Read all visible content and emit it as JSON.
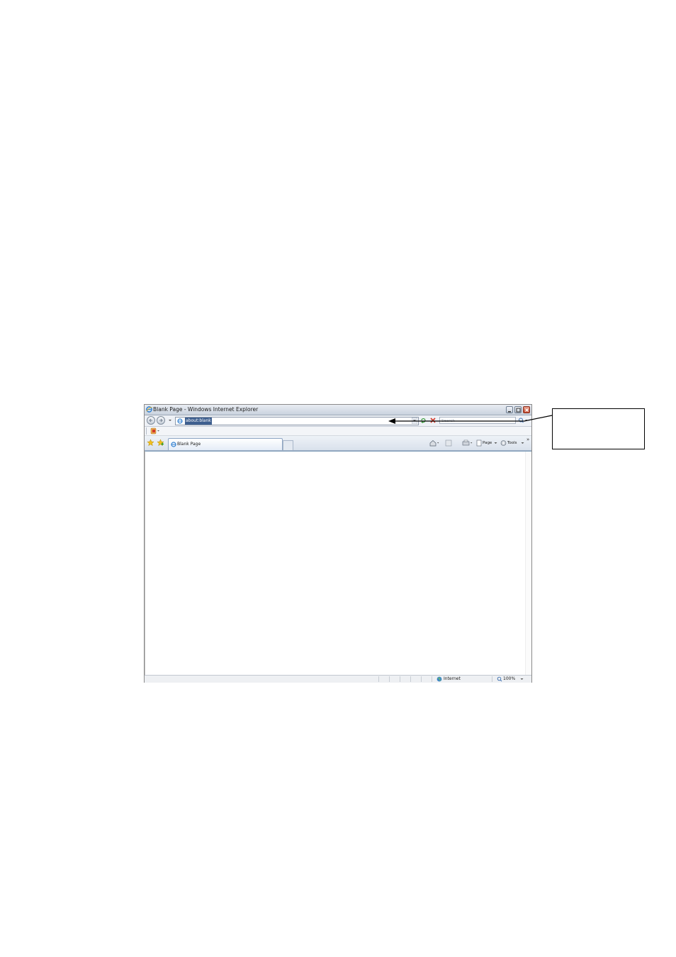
{
  "window": {
    "title": "Blank Page - Windows Internet Explorer"
  },
  "navigation": {
    "address_value": "about:blank",
    "search_placeholder": "Search"
  },
  "tabs": [
    {
      "label": "Blank Page",
      "active": true
    }
  ],
  "command_bar": {
    "page_label": "Page",
    "tools_label": "Tools",
    "overflow_label": "»"
  },
  "status_bar": {
    "zone": "Internet",
    "zoom": "100%"
  },
  "icons": [
    "ie-logo-icon",
    "minimize-icon",
    "maximize-icon",
    "close-icon",
    "back-arrow-icon",
    "forward-arrow-icon",
    "chevron-down-icon",
    "page-icon",
    "refresh-icon",
    "stop-icon",
    "search-icon",
    "feed-icon",
    "favorites-star-icon",
    "add-favorites-icon",
    "home-icon",
    "rss-icon",
    "print-icon",
    "page-menu-icon",
    "tools-gear-icon",
    "globe-icon",
    "zoom-icon"
  ],
  "colors": {
    "address_highlight": "#3e5f8f",
    "close_button": "#c0442a",
    "favorites_star": "#f2c01e"
  }
}
